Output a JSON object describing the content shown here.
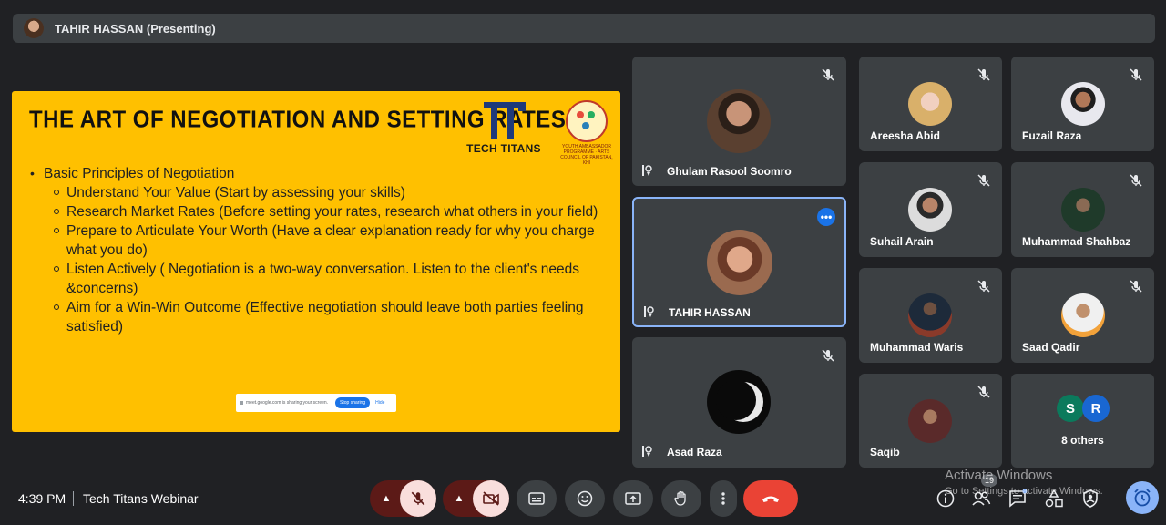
{
  "presenter_bar": {
    "name": "TAHIR HASSAN (Presenting)"
  },
  "slide": {
    "title": "THE ART OF NEGOTIATION AND SETTING RATES",
    "logo_text": "TECH TITANS",
    "ya_logo_text": "YOUTH AMBASSADOR PROGRAMME · ARTS COUNCIL OF PAKISTAN, KHI",
    "bullet_main": "Basic Principles of Negotiation",
    "sub_bullets": [
      "Understand Your Value (Start by assessing your skills)",
      "Research Market Rates (Before setting your rates, research what others in your field)",
      "Prepare to Articulate Your Worth (Have a clear explanation ready for why you charge what you do)",
      "Listen Actively ( Negotiation is a two-way conversation. Listen to the client's needs &concerns)",
      "Aim for a Win-Win Outcome (Effective negotiation should leave both parties feeling satisfied)"
    ],
    "share_notice": "meet.google.com is sharing your screen.",
    "stop_sharing": "Stop sharing",
    "hide": "Hide"
  },
  "tiles_large": [
    {
      "name": "Ghulam Rasool Soomro"
    },
    {
      "name": "TAHIR HASSAN"
    },
    {
      "name": "Asad Raza"
    }
  ],
  "tiles_small": [
    {
      "name": "Areesha Abid"
    },
    {
      "name": "Fuzail Raza"
    },
    {
      "name": "Suhail Arain"
    },
    {
      "name": "Muhammad Shahbaz"
    },
    {
      "name": "Muhammad Waris"
    },
    {
      "name": "Saad Qadir"
    },
    {
      "name": "Saqib"
    }
  ],
  "others": {
    "letters": [
      "S",
      "R"
    ],
    "label": "8 others",
    "colors": [
      "#0b7a5c",
      "#1967d2"
    ]
  },
  "bottom": {
    "time": "4:39 PM",
    "meeting": "Tech Titans Webinar",
    "people_count": "19",
    "watermark_title": "Activate Windows",
    "watermark_sub": "Go to Settings to activate Windows."
  },
  "colors": {
    "slide_bg": "#ffc000",
    "end_call": "#ea4335",
    "active_border": "#8ab4f8"
  }
}
